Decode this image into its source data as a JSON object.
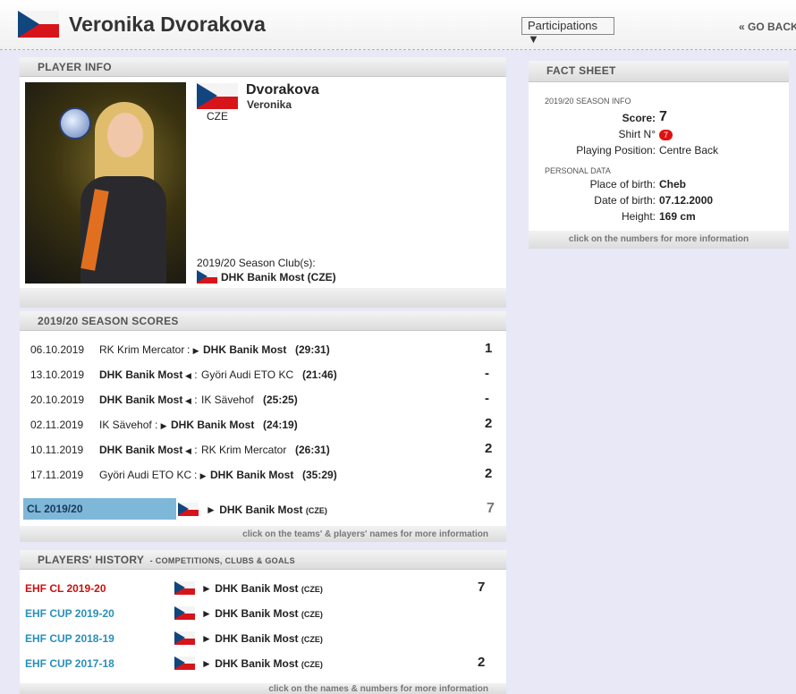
{
  "header": {
    "title": "Veronika Dvorakova",
    "participations_label": "Participations ▼",
    "go_back_label": "« GO BACK"
  },
  "player_info": {
    "section_title": "PLAYER INFO",
    "last_name": "Dvorakova",
    "first_name": "Veronika",
    "country": "CZE",
    "club_label": "2019/20 Season Club(s):",
    "club": "DHK Banik Most (CZE)"
  },
  "fact_sheet": {
    "section_title": "FACT SHEET",
    "season_info_label": "2019/20 SEASON INFO",
    "score_label": "Score:",
    "score_value": "7",
    "shirt_label": "Shirt N°",
    "shirt_value": "7",
    "position_label": "Playing Position:",
    "position_value": "Centre Back",
    "personal_data_label": "PERSONAL DATA",
    "birthplace_label": "Place of birth:",
    "birthplace_value": "Cheb",
    "dob_label": "Date of birth:",
    "dob_value": "07.12.2000",
    "height_label": "Height:",
    "height_value": "169 cm",
    "footer": "click on the numbers for more information"
  },
  "season_scores": {
    "section_title": "2019/20 SEASON SCORES",
    "matches": [
      {
        "date": "06.10.2019",
        "home": "RK Krim Mercator",
        "away": "DHK Banik Most",
        "score": "(29:31)",
        "goals": "1"
      },
      {
        "date": "13.10.2019",
        "home": "DHK Banik Most",
        "away": "Györi Audi ETO KC",
        "score": "(21:46)",
        "goals": "-"
      },
      {
        "date": "20.10.2019",
        "home": "DHK Banik Most",
        "away": "IK Sävehof",
        "score": "(25:25)",
        "goals": "-"
      },
      {
        "date": "02.11.2019",
        "home": "IK Sävehof",
        "away": "DHK Banik Most",
        "score": "(24:19)",
        "goals": "2"
      },
      {
        "date": "10.11.2019",
        "home": "DHK Banik Most",
        "away": "RK Krim Mercator",
        "score": "(26:31)",
        "goals": "2"
      },
      {
        "date": "17.11.2019",
        "home": "Györi Audi ETO KC",
        "away": "DHK Banik Most",
        "score": "(35:29)",
        "goals": "2"
      }
    ],
    "competition": {
      "label": "CL 2019/20",
      "club": "► DHK Banik Most",
      "country": "(CZE)",
      "goals": "7"
    },
    "footer": "click on the teams' & players' names for more information"
  },
  "history": {
    "section_title": "PLAYERS' HISTORY",
    "section_subtitle": "- COMPETITIONS, CLUBS & GOALS",
    "rows": [
      {
        "competition": "EHF CL 2019-20",
        "color": "#cc1010",
        "club": "► DHK Banik Most",
        "country": "(CZE)",
        "goals": "7"
      },
      {
        "competition": "EHF CUP 2019-20",
        "color": "#2a8fb8",
        "club": "► DHK Banik Most",
        "country": "(CZE)",
        "goals": ""
      },
      {
        "competition": "EHF CUP 2018-19",
        "color": "#2a8fb8",
        "club": "► DHK Banik Most",
        "country": "(CZE)",
        "goals": ""
      },
      {
        "competition": "EHF CUP 2017-18",
        "color": "#2a8fb8",
        "club": "► DHK Banik Most",
        "country": "(CZE)",
        "goals": "2"
      }
    ],
    "footer": "click on the names & numbers for more information"
  },
  "colors": {
    "page_background": "#e8e8f6",
    "competition_highlight": "#7fb7d8",
    "cl_red": "#cc1010",
    "cup_blue": "#2a8fb8",
    "shirt_badge": "#e01010",
    "flag_white": "#f4f4f4",
    "flag_red": "#d7141a",
    "flag_blue": "#11457e"
  },
  "icons": [
    "czech-flag-icon",
    "triangle-right-icon",
    "triangle-left-icon"
  ]
}
